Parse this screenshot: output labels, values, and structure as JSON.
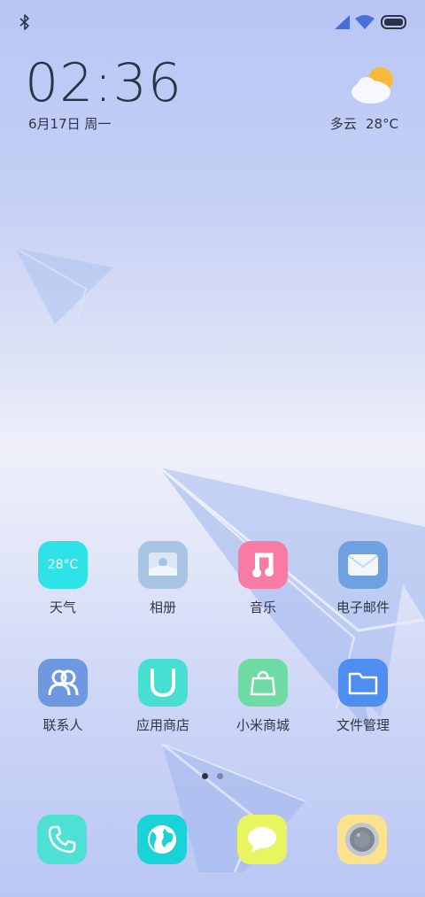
{
  "status_bar": {
    "icons": [
      "bluetooth-icon",
      "cellular-signal-icon",
      "wifi-icon",
      "battery-icon"
    ]
  },
  "clock": {
    "time": "02:36",
    "date": "6月17日 周一"
  },
  "weather": {
    "condition": "多云",
    "temperature": "28°C",
    "icon": "partly-cloudy-icon"
  },
  "apps": [
    {
      "label": "天气",
      "icon": "weather-icon",
      "icon_text": "28°C",
      "color": "#2ee3e8"
    },
    {
      "label": "相册",
      "icon": "gallery-icon",
      "color": "#a9c4e2"
    },
    {
      "label": "音乐",
      "icon": "music-icon",
      "color": "#f97aa5"
    },
    {
      "label": "电子邮件",
      "icon": "mail-icon",
      "color": "#6fa0e2"
    },
    {
      "label": "联系人",
      "icon": "contacts-icon",
      "color": "#6e98e0"
    },
    {
      "label": "应用商店",
      "icon": "app-store-icon",
      "color": "#47dfd2"
    },
    {
      "label": "小米商城",
      "icon": "shopping-bag-icon",
      "color": "#6fdba4"
    },
    {
      "label": "文件管理",
      "icon": "folder-icon",
      "color": "#4f8ef0"
    }
  ],
  "page_indicator": {
    "count": 2,
    "active": 1,
    "active_color": "#2b3446",
    "inactive_color": "#7b86a6"
  },
  "dock": [
    {
      "icon": "phone-icon",
      "color": "#4ee0d5"
    },
    {
      "icon": "browser-icon",
      "color": "#19d3d8"
    },
    {
      "icon": "messages-icon",
      "color": "#e6f560"
    },
    {
      "icon": "camera-icon",
      "color": "#fbe28c"
    }
  ]
}
